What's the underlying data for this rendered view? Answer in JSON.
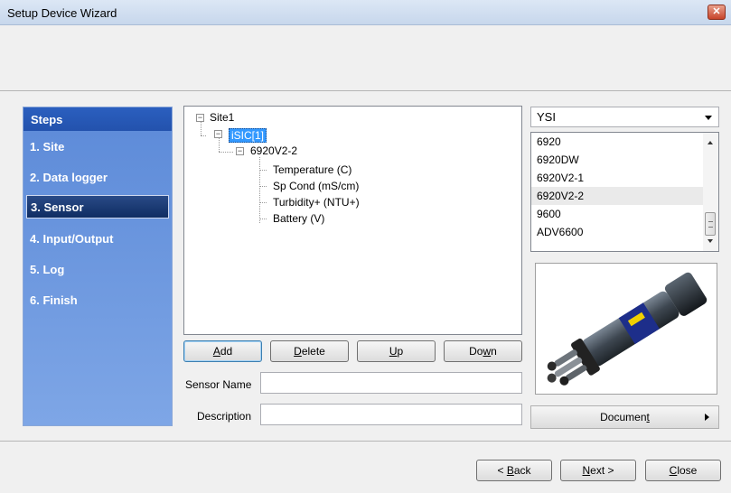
{
  "window": {
    "title": "Setup Device Wizard",
    "close_glyph": "✕"
  },
  "steps": {
    "heading": "Steps",
    "items": [
      {
        "label": "1. Site",
        "active": false
      },
      {
        "label": "2. Data logger",
        "active": false
      },
      {
        "label": "3. Sensor",
        "active": true
      },
      {
        "label": "4. Input/Output",
        "active": false
      },
      {
        "label": "5. Log",
        "active": false
      },
      {
        "label": "6. Finish",
        "active": false
      }
    ]
  },
  "tree": {
    "site": "Site1",
    "logger": "iSIC[1]",
    "device": "6920V2-2",
    "sensors": [
      "Temperature (C)",
      "Sp Cond (mS/cm)",
      "Turbidity+ (NTU+)",
      "Battery (V)"
    ]
  },
  "actions": {
    "add": {
      "ul": "A",
      "rest": "dd"
    },
    "delete": {
      "ul": "D",
      "rest": "elete"
    },
    "up": {
      "ul": "U",
      "rest": "p"
    },
    "down": {
      "pre": "Do",
      "ul": "w",
      "rest": "n"
    }
  },
  "fields": {
    "sensor_name": {
      "label": "Sensor Name",
      "value": ""
    },
    "description": {
      "label": "Description",
      "value": ""
    }
  },
  "manufacturer": {
    "selected": "YSI"
  },
  "models": {
    "items": [
      "6920",
      "6920DW",
      "6920V2-1",
      "6920V2-2",
      "9600",
      "ADV6600"
    ],
    "selected": "6920V2-2"
  },
  "document_button": {
    "pre": "Documen",
    "ul": "t"
  },
  "nav": {
    "back": {
      "pre": "< ",
      "ul": "B",
      "rest": "ack"
    },
    "next": {
      "ul": "N",
      "rest": "ext >"
    },
    "close": {
      "ul": "C",
      "rest": "lose"
    }
  },
  "colors": {
    "steps_panel": "#6f99e0",
    "steps_header": "#2856b5",
    "steps_active": "#1a3a74",
    "tree_selection": "#3399ff",
    "title_close": "#c7442a"
  },
  "icons": {
    "expander_collapse": "minus-box-icon",
    "combo_arrow": "chevron-down-icon",
    "document_arrow": "chevron-right-icon",
    "device_image": "sonde-probe-image"
  }
}
